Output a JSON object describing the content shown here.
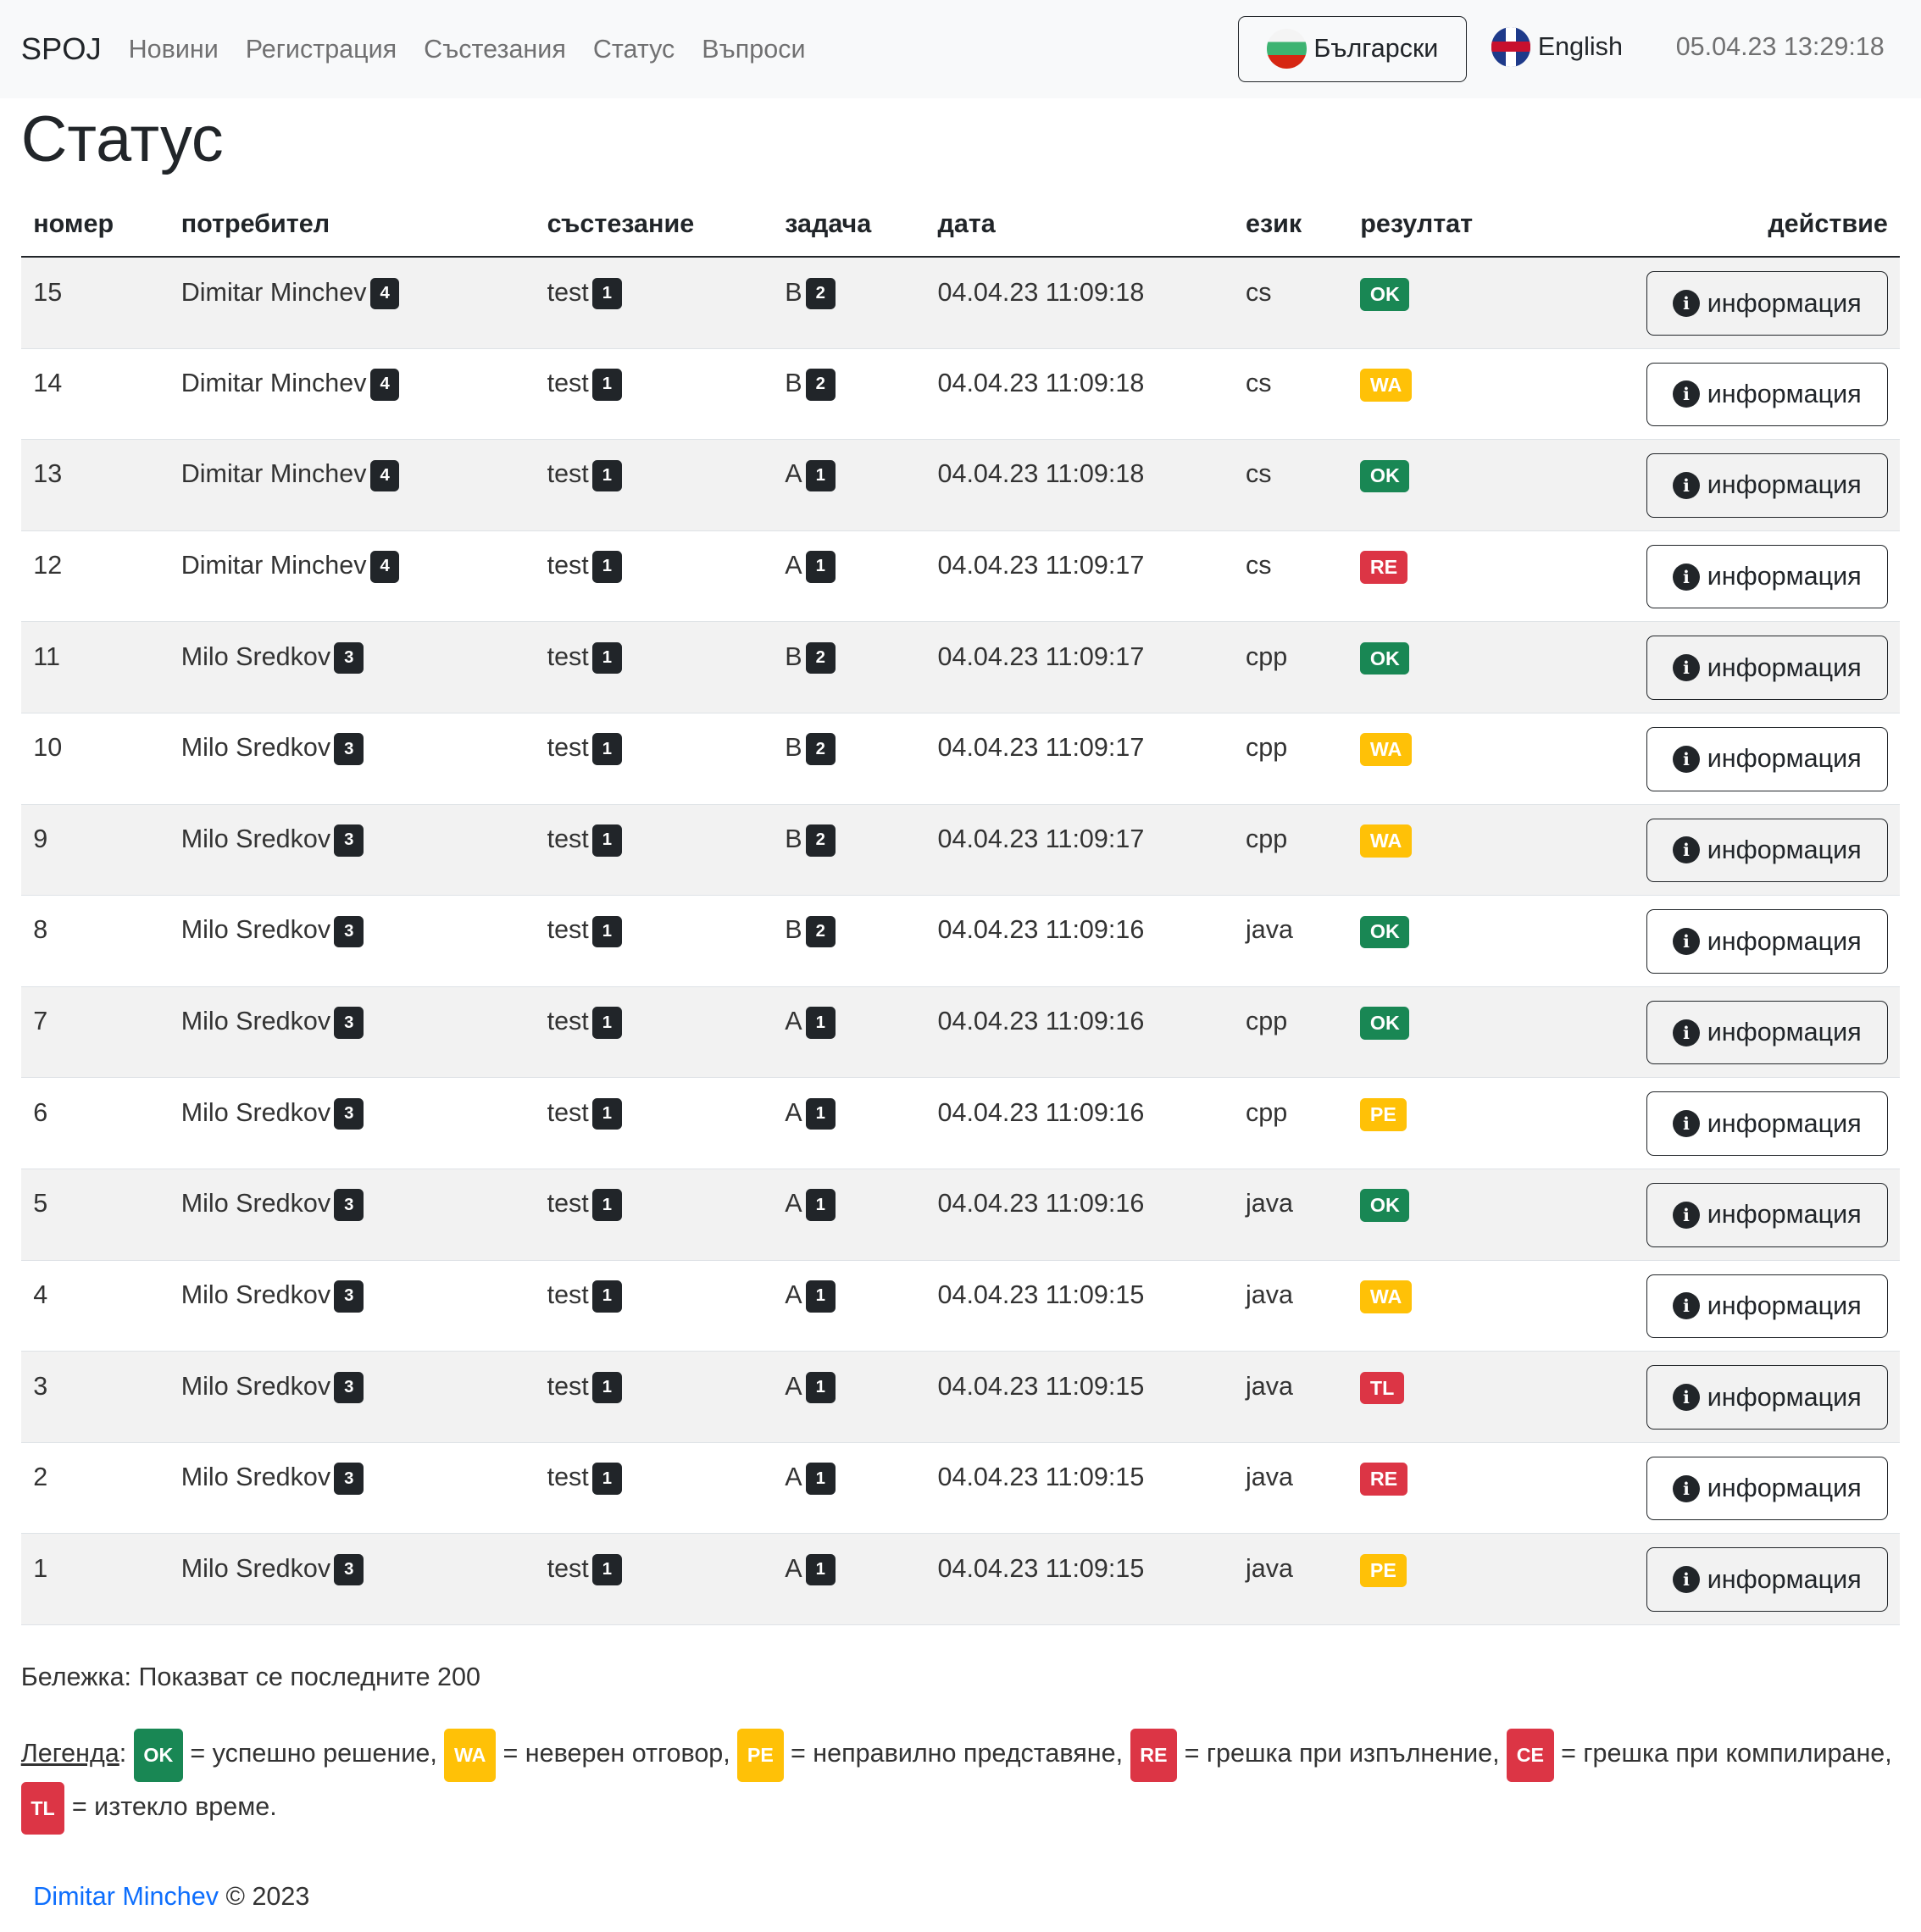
{
  "nav": {
    "brand": "SPOJ",
    "links": [
      "Новини",
      "Регистрация",
      "Състезания",
      "Статус",
      "Въпроси"
    ],
    "lang_bg": "Български",
    "lang_en": "English",
    "clock": "05.04.23 13:29:18"
  },
  "page_title": "Статус",
  "columns": [
    "номер",
    "потребител",
    "състезание",
    "задача",
    "дата",
    "език",
    "резултат",
    "действие"
  ],
  "info_label": "информация",
  "rows": [
    {
      "id": "15",
      "user": "Dimitar Minchev",
      "uc": "4",
      "contest": "test",
      "cc": "1",
      "task": "B",
      "tc": "2",
      "date": "04.04.23 11:09:18",
      "lang": "cs",
      "result": "OK"
    },
    {
      "id": "14",
      "user": "Dimitar Minchev",
      "uc": "4",
      "contest": "test",
      "cc": "1",
      "task": "B",
      "tc": "2",
      "date": "04.04.23 11:09:18",
      "lang": "cs",
      "result": "WA"
    },
    {
      "id": "13",
      "user": "Dimitar Minchev",
      "uc": "4",
      "contest": "test",
      "cc": "1",
      "task": "A",
      "tc": "1",
      "date": "04.04.23 11:09:18",
      "lang": "cs",
      "result": "OK"
    },
    {
      "id": "12",
      "user": "Dimitar Minchev",
      "uc": "4",
      "contest": "test",
      "cc": "1",
      "task": "A",
      "tc": "1",
      "date": "04.04.23 11:09:17",
      "lang": "cs",
      "result": "RE"
    },
    {
      "id": "11",
      "user": "Milo Sredkov",
      "uc": "3",
      "contest": "test",
      "cc": "1",
      "task": "B",
      "tc": "2",
      "date": "04.04.23 11:09:17",
      "lang": "cpp",
      "result": "OK"
    },
    {
      "id": "10",
      "user": "Milo Sredkov",
      "uc": "3",
      "contest": "test",
      "cc": "1",
      "task": "B",
      "tc": "2",
      "date": "04.04.23 11:09:17",
      "lang": "cpp",
      "result": "WA"
    },
    {
      "id": "9",
      "user": "Milo Sredkov",
      "uc": "3",
      "contest": "test",
      "cc": "1",
      "task": "B",
      "tc": "2",
      "date": "04.04.23 11:09:17",
      "lang": "cpp",
      "result": "WA"
    },
    {
      "id": "8",
      "user": "Milo Sredkov",
      "uc": "3",
      "contest": "test",
      "cc": "1",
      "task": "B",
      "tc": "2",
      "date": "04.04.23 11:09:16",
      "lang": "java",
      "result": "OK"
    },
    {
      "id": "7",
      "user": "Milo Sredkov",
      "uc": "3",
      "contest": "test",
      "cc": "1",
      "task": "A",
      "tc": "1",
      "date": "04.04.23 11:09:16",
      "lang": "cpp",
      "result": "OK"
    },
    {
      "id": "6",
      "user": "Milo Sredkov",
      "uc": "3",
      "contest": "test",
      "cc": "1",
      "task": "A",
      "tc": "1",
      "date": "04.04.23 11:09:16",
      "lang": "cpp",
      "result": "PE"
    },
    {
      "id": "5",
      "user": "Milo Sredkov",
      "uc": "3",
      "contest": "test",
      "cc": "1",
      "task": "A",
      "tc": "1",
      "date": "04.04.23 11:09:16",
      "lang": "java",
      "result": "OK"
    },
    {
      "id": "4",
      "user": "Milo Sredkov",
      "uc": "3",
      "contest": "test",
      "cc": "1",
      "task": "A",
      "tc": "1",
      "date": "04.04.23 11:09:15",
      "lang": "java",
      "result": "WA"
    },
    {
      "id": "3",
      "user": "Milo Sredkov",
      "uc": "3",
      "contest": "test",
      "cc": "1",
      "task": "A",
      "tc": "1",
      "date": "04.04.23 11:09:15",
      "lang": "java",
      "result": "TL"
    },
    {
      "id": "2",
      "user": "Milo Sredkov",
      "uc": "3",
      "contest": "test",
      "cc": "1",
      "task": "A",
      "tc": "1",
      "date": "04.04.23 11:09:15",
      "lang": "java",
      "result": "RE"
    },
    {
      "id": "1",
      "user": "Milo Sredkov",
      "uc": "3",
      "contest": "test",
      "cc": "1",
      "task": "A",
      "tc": "1",
      "date": "04.04.23 11:09:15",
      "lang": "java",
      "result": "PE"
    }
  ],
  "note": "Бележка: Показват се последните 200",
  "legend": {
    "title": "Легенда",
    "items": [
      {
        "code": "OK",
        "text": " = успешно решение, "
      },
      {
        "code": "WA",
        "text": " = неверен отговор, "
      },
      {
        "code": "PE",
        "text": " = неправилно представяне, "
      },
      {
        "code": "RE",
        "text": " = грешка при изпълнение, "
      },
      {
        "code": "CE",
        "text": " = грешка при компилиране, "
      },
      {
        "code": "TL",
        "text": " = изтекло време."
      }
    ]
  },
  "footer": {
    "author": "Dimitar Minchev",
    "copy": " © 2023"
  }
}
